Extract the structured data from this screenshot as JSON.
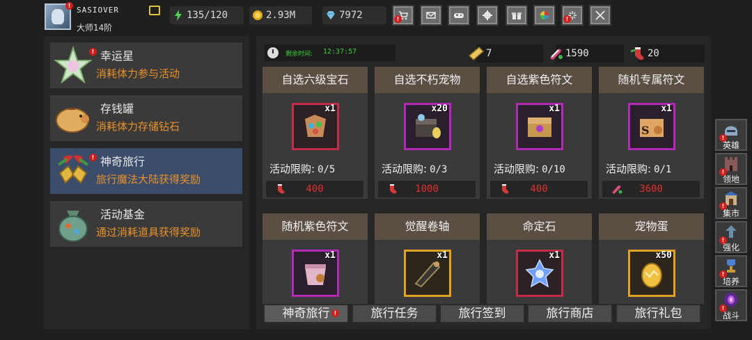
{
  "player": {
    "name": "SASIOVER",
    "rank": "大师14阶"
  },
  "resources": {
    "stamina": "135/120",
    "gold": "2.93M",
    "gems": "7972"
  },
  "toolbar": [
    "shop-cart-icon",
    "mail-icon",
    "gamepad-icon",
    "gear-icon",
    "gift-icon",
    "color-wheel-icon",
    "firework-icon",
    "crossed-swords-icon"
  ],
  "sidebar": [
    {
      "title": "幸运星",
      "desc": "消耗体力参与活动",
      "icon": "lucky-star-icon",
      "alert": true,
      "active": false
    },
    {
      "title": "存钱罐",
      "desc": "消耗体力存储钻石",
      "icon": "piggy-bank-icon",
      "alert": false,
      "active": false
    },
    {
      "title": "神奇旅行",
      "desc": "旅行魔法大陆获得奖励",
      "icon": "gift-bell-icon",
      "alert": true,
      "active": true
    },
    {
      "title": "活动基金",
      "desc": "通过消耗道具获得奖励",
      "icon": "fund-bag-icon",
      "alert": false,
      "active": false
    }
  ],
  "timer": {
    "label": "剩余时间:",
    "value": "12:37:57"
  },
  "currencies": [
    {
      "icon": "ticket-icon",
      "value": "7"
    },
    {
      "icon": "candy-icon",
      "value": "1590"
    },
    {
      "icon": "sock-icon",
      "value": "20"
    }
  ],
  "limit_label": "活动限购:",
  "items": [
    {
      "title": "自选六级宝石",
      "qty": "x1",
      "limit": "0/5",
      "price": "400",
      "frame": "red",
      "art": "gem-pack-icon"
    },
    {
      "title": "自选不朽宠物",
      "qty": "x20",
      "limit": "0/3",
      "price": "1000",
      "frame": "purple",
      "art": "pet-chest-icon"
    },
    {
      "title": "自选紫色符文",
      "qty": "x1",
      "limit": "0/10",
      "price": "400",
      "frame": "purple",
      "art": "rune-chest-icon"
    },
    {
      "title": "随机专属符文",
      "qty": "x1",
      "limit": "0/1",
      "price": "3600",
      "frame": "purple",
      "art": "exclusive-rune-icon"
    },
    {
      "title": "随机紫色符文",
      "qty": "x1",
      "frame": "purple",
      "art": "rune-bag-icon"
    },
    {
      "title": "觉醒卷轴",
      "qty": "x1",
      "frame": "gold",
      "art": "scroll-icon"
    },
    {
      "title": "命定石",
      "qty": "x1",
      "frame": "red",
      "art": "destiny-stone-icon"
    },
    {
      "title": "宠物蛋",
      "qty": "x50",
      "frame": "gold",
      "art": "pet-egg-icon"
    }
  ],
  "tabs": [
    {
      "label": "神奇旅行",
      "alert": true
    },
    {
      "label": "旅行任务",
      "alert": false
    },
    {
      "label": "旅行签到",
      "alert": false
    },
    {
      "label": "旅行商店",
      "alert": false
    },
    {
      "label": "旅行礼包",
      "alert": false
    }
  ],
  "sidenav": [
    {
      "label": "英雄",
      "icon": "helmet-icon",
      "alert": true
    },
    {
      "label": "领地",
      "icon": "castle-icon",
      "alert": true
    },
    {
      "label": "集市",
      "icon": "market-icon",
      "alert": true
    },
    {
      "label": "强化",
      "icon": "upgrade-icon",
      "alert": true
    },
    {
      "label": "培养",
      "icon": "trophy-icon",
      "alert": true
    },
    {
      "label": "战斗",
      "icon": "portal-icon",
      "alert": true
    }
  ],
  "colors": {
    "accent_orange": "#e9912a",
    "alert_red": "#d21d1d",
    "timer_green": "#3bd13b",
    "price_red": "#e0312f",
    "active_blue": "#3b4c6b"
  }
}
